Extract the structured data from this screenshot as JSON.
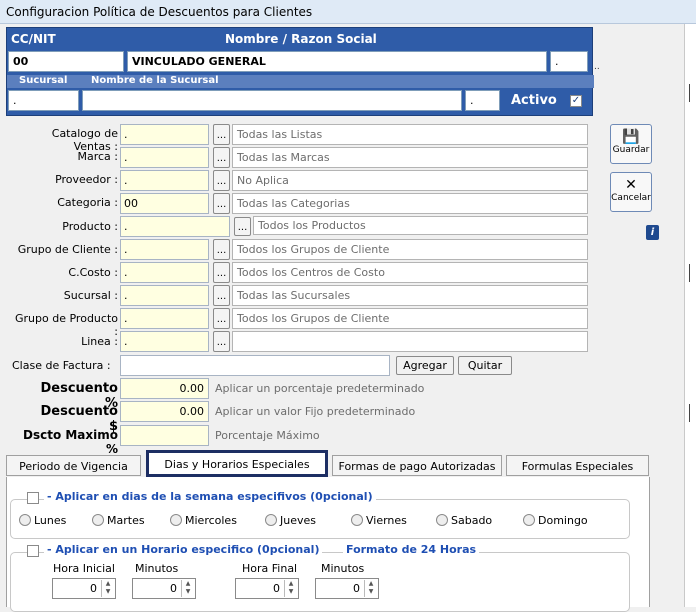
{
  "window": {
    "title": "Configuracion Política de Descuentos para Clientes"
  },
  "header": {
    "ccnit_label": "CC/NIT",
    "nombre_label": "Nombre / Razon Social",
    "ccnit_value": "00",
    "nombre_value": "VINCULADO GENERAL",
    "extra_value": ".",
    "trailing_dots": "..",
    "sucursal_label": "Sucursal",
    "nombre_sucursal_label": "Nombre de la Sucursal",
    "sucursal_value": ".",
    "nombre_sucursal_value": "",
    "sucursal_extra_value": ".",
    "activo_label": "Activo",
    "activo_checked": "✓"
  },
  "form": {
    "rows": [
      {
        "label": "Catalogo de Ventas :",
        "value": ".",
        "desc": "Todas las Listas"
      },
      {
        "label": "Marca :",
        "value": ".",
        "desc": "Todas las Marcas"
      },
      {
        "label": "Proveedor :",
        "value": ".",
        "desc": "No Aplica"
      },
      {
        "label": "Categoria :",
        "value": "00",
        "desc": "Todas las Categorias"
      },
      {
        "label": "Producto :",
        "value": ".",
        "desc": "Todos los Productos"
      },
      {
        "label": "Grupo de Cliente :",
        "value": ".",
        "desc": "Todos los Grupos de Cliente"
      },
      {
        "label": "C.Costo :",
        "value": ".",
        "desc": "Todos los Centros de Costo"
      },
      {
        "label": "Sucursal :",
        "value": ".",
        "desc": "Todas las Sucursales"
      },
      {
        "label": "Grupo de Producto :",
        "value": ".",
        "desc": "Todos los Grupos de Cliente"
      },
      {
        "label": "Linea :",
        "value": ".",
        "desc": ""
      }
    ],
    "browse_label": "...",
    "clase_factura_label": "Clase de Factura :",
    "clase_factura_value": "",
    "agregar_label": "Agregar",
    "quitar_label": "Quitar",
    "descuento_pct_label": "Descuento %",
    "descuento_pct_value": "0.00",
    "descuento_pct_hint": "Aplicar un porcentaje predeterminado",
    "descuento_val_label": "Descuento $",
    "descuento_val_value": "0.00",
    "descuento_val_hint": "Aplicar un valor Fijo predeterminado",
    "dscto_max_label": "Dscto Maximo %",
    "dscto_max_value": "",
    "dscto_max_hint": "Porcentaje Máximo"
  },
  "side": {
    "guardar_label": "Guardar",
    "cancelar_label": "Cancelar",
    "info_label": "i"
  },
  "tabs": [
    {
      "label": "Periodo de  Vigencia"
    },
    {
      "label": "Dias y Horarios Especiales"
    },
    {
      "label": "Formas de pago Autorizadas"
    },
    {
      "label": "Formulas Especiales"
    }
  ],
  "dias": {
    "title": "- Aplicar en dias de la semana especifivos  (0pcional)",
    "days": [
      "Lunes",
      "Martes",
      "Miercoles",
      "Jueves",
      "Viernes",
      "Sabado",
      "Domingo"
    ]
  },
  "horario": {
    "title": "- Aplicar en un Horario  especifico  (0pcional)",
    "format_label": "Formato de 24 Horas",
    "hora_inicial_label": "Hora Inicial",
    "minutos1_label": "Minutos",
    "hora_final_label": "Hora Final",
    "minutos2_label": "Minutos",
    "hora_inicial_value": "0",
    "minutos1_value": "0",
    "hora_final_value": "0",
    "minutos2_value": "0"
  }
}
